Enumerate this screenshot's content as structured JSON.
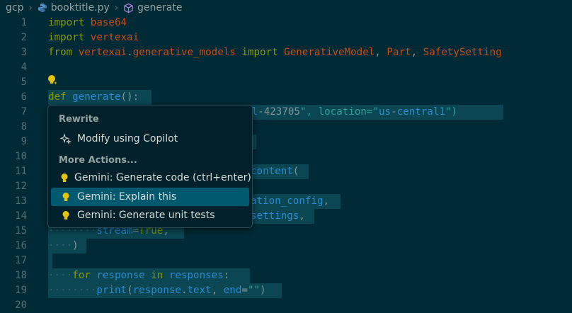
{
  "breadcrumb": {
    "folder": "gcp",
    "file": "booktitle.py",
    "symbol": "generate"
  },
  "lines": [
    {
      "num": "1",
      "code": "import base64"
    },
    {
      "num": "2",
      "code": "import vertexai"
    },
    {
      "num": "3",
      "code": "from vertexai.generative_models import GenerativeModel, Part, SafetySetting"
    },
    {
      "num": "4",
      "code": ""
    },
    {
      "num": "5",
      "code": ""
    },
    {
      "num": "6",
      "code": "def generate():"
    },
    {
      "num": "7",
      "code": "rial-423705\", location=\"us-central1\")"
    },
    {
      "num": "8",
      "code": ""
    },
    {
      "num": "9",
      "code": ""
    },
    {
      "num": "10",
      "code": ""
    },
    {
      "num": "11",
      "code": "content("
    },
    {
      "num": "12",
      "code": ""
    },
    {
      "num": "13",
      "code": "ation_config,"
    },
    {
      "num": "14",
      "code": "settings,"
    },
    {
      "num": "15",
      "code": "stream=True,"
    },
    {
      "num": "16",
      "code": ")"
    },
    {
      "num": "17",
      "code": ""
    },
    {
      "num": "18",
      "code": "for response in responses:"
    },
    {
      "num": "19",
      "code": "print(response.text, end=\"\")"
    },
    {
      "num": "20",
      "code": ""
    }
  ],
  "menu": {
    "rewrite_header": "Rewrite",
    "modify": "Modify using Copilot",
    "more_header": "More Actions...",
    "items": [
      "Gemini: Generate code (ctrl+enter)",
      "Gemini: Explain this",
      "Gemini: Generate unit tests"
    ]
  },
  "colors": {
    "background": "#002b36",
    "keyword": "#859900",
    "module": "#cb4b16",
    "function": "#268bd2",
    "string": "#2aa198",
    "active_menu_item": "#005a6f"
  },
  "icons": {
    "python": "python-file-icon",
    "symbol": "method-cube-icon",
    "bulb": "lightbulb-icon",
    "sparkle": "sparkle-icon"
  }
}
